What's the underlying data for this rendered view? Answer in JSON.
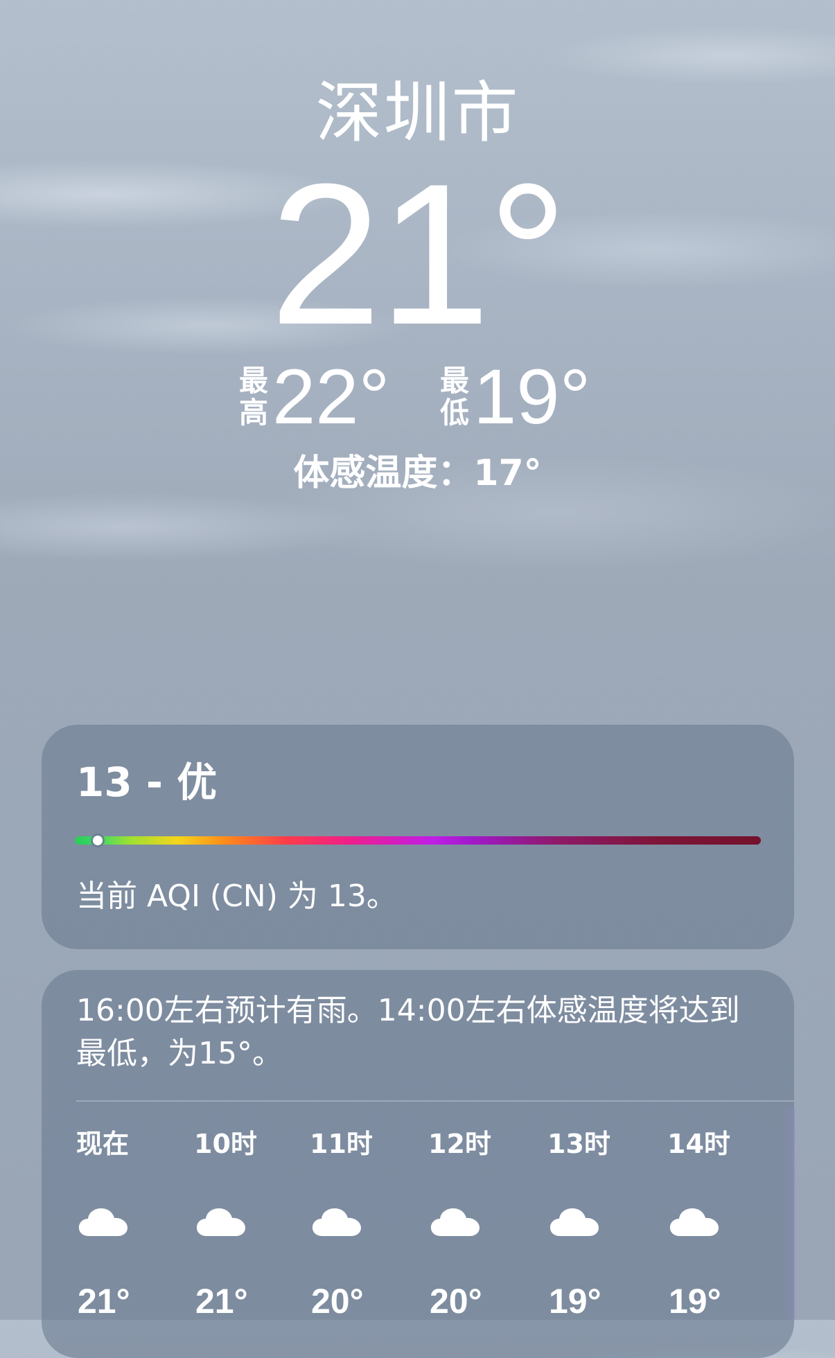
{
  "location": {
    "city": "深圳市"
  },
  "current": {
    "temperature": "21°",
    "high_label_top": "最",
    "high_label_bottom": "高",
    "high": "22°",
    "low_label_top": "最",
    "low_label_bottom": "低",
    "low": "19°",
    "feels_like": "体感温度：17°"
  },
  "aqi": {
    "headline": "13 - 优",
    "level": 13,
    "description": "当前 AQI (CN) 为 13。",
    "colors": {
      "good": "#2ecc55",
      "moderate": "#f3d51c",
      "unhealthy": "#ff3b4b",
      "very_unhealthy": "#c01ee6",
      "hazardous": "#74122c"
    }
  },
  "forecast": {
    "summary": "16:00左右预计有雨。14:00左右体感温度将达到最低，为15°。",
    "hours": [
      {
        "time": "现在",
        "icon": "cloud-icon",
        "temp": "21°"
      },
      {
        "time": "10时",
        "icon": "cloud-icon",
        "temp": "21°"
      },
      {
        "time": "11时",
        "icon": "cloud-icon",
        "temp": "20°"
      },
      {
        "time": "12时",
        "icon": "cloud-icon",
        "temp": "20°"
      },
      {
        "time": "13时",
        "icon": "cloud-icon",
        "temp": "19°"
      },
      {
        "time": "14时",
        "icon": "cloud-icon",
        "temp": "19°"
      }
    ]
  }
}
